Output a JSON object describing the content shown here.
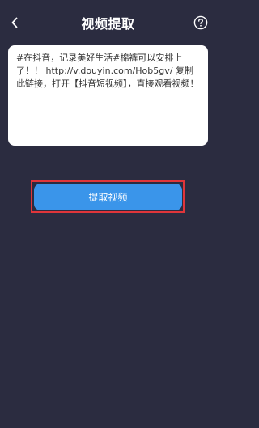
{
  "header": {
    "title": "视频提取",
    "back_icon": "chevron-left-icon",
    "help_icon": "question-circle-icon"
  },
  "input": {
    "text": "#在抖音，记录美好生活#棉裤可以安排上了！！ http://v.douyin.com/Hob5gv/ 复制此链接，打开【抖音短视频】，直接观看视频！"
  },
  "action": {
    "extract_label": "提取视频"
  },
  "colors": {
    "background": "#2b2c40",
    "card": "#ffffff",
    "button": "#3a95ea",
    "highlight": "#e0353a"
  }
}
